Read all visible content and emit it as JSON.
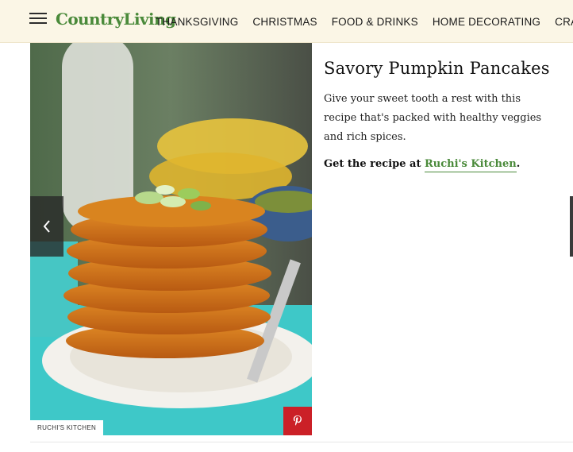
{
  "header": {
    "logo": "CountryLiving",
    "menu_icon": "hamburger-menu-icon",
    "nav": [
      {
        "label": "THANKSGIVING"
      },
      {
        "label": "CHRISTMAS"
      },
      {
        "label": "FOOD & DRINKS"
      },
      {
        "label": "HOME DECORATING"
      },
      {
        "label": "CRAFTS & DIY"
      }
    ]
  },
  "slide": {
    "image_credit": "RUCHI'S KITCHEN",
    "pin_icon": "pinterest-icon",
    "prev_icon": "chevron-left-icon",
    "title": "Savory Pumpkin Pancakes",
    "description": "Give your sweet tooth a rest with this recipe that's packed with healthy veggies and rich spices.",
    "cta_prefix": "Get the recipe at ",
    "cta_link": "Ruchi's Kitchen",
    "cta_suffix": "."
  },
  "colors": {
    "brand_green": "#4a8a3a",
    "header_bg": "#fbf6e6",
    "pinterest_red": "#cb2027"
  }
}
